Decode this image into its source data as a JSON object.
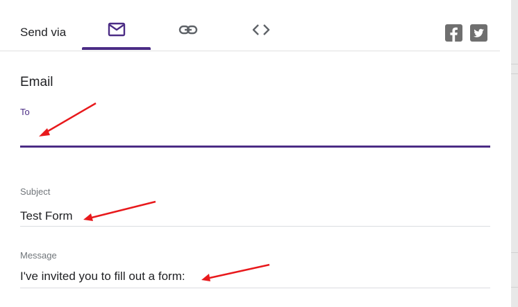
{
  "header": {
    "send_via_label": "Send via",
    "tabs": [
      {
        "icon": "envelope-icon",
        "selected": true
      },
      {
        "icon": "link-icon",
        "selected": false
      },
      {
        "icon": "code-brackets-icon",
        "selected": false
      }
    ],
    "social": [
      {
        "icon": "facebook-icon"
      },
      {
        "icon": "twitter-icon"
      }
    ]
  },
  "email": {
    "title": "Email",
    "to": {
      "label": "To",
      "value": ""
    },
    "subject": {
      "label": "Subject",
      "value": "Test Form"
    },
    "message": {
      "label": "Message",
      "value": "I've invited you to fill out a form:"
    }
  },
  "colors": {
    "accent": "#4b2c85",
    "icon_grey": "#5f6368",
    "social_grey": "#6f6f6f",
    "annotation_red": "#e8191c"
  }
}
